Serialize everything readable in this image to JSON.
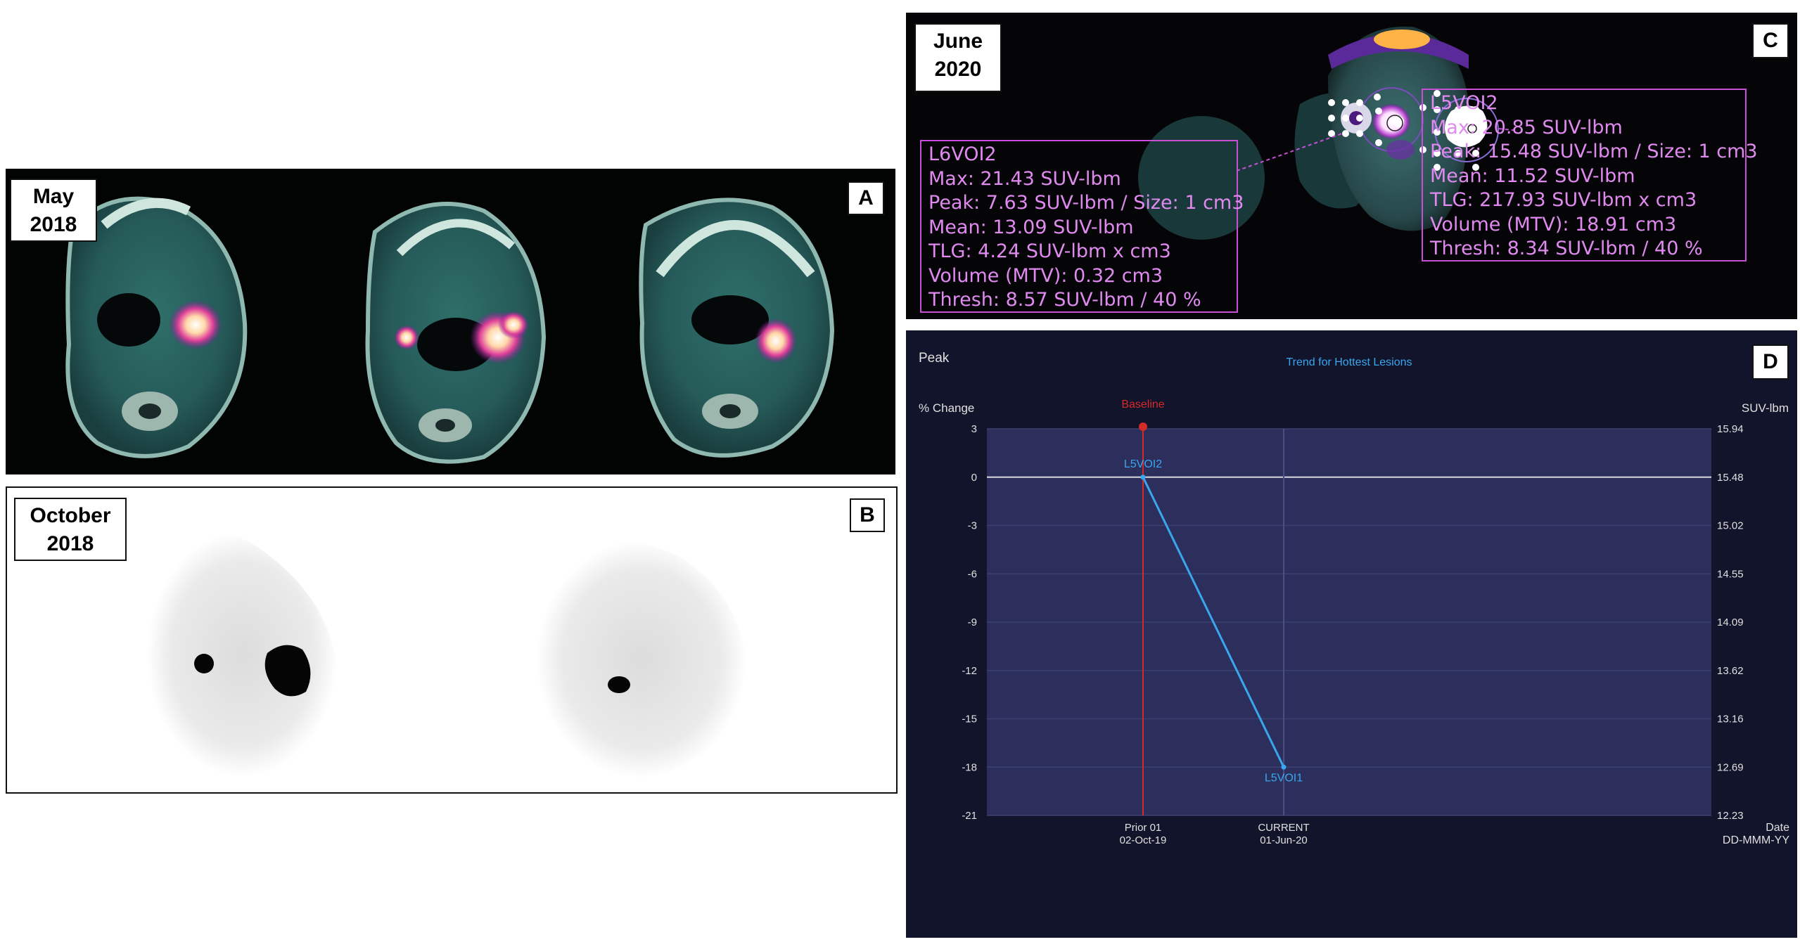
{
  "panel_a": {
    "letter": "A",
    "date_line1": "May",
    "date_line2": "2018"
  },
  "panel_b": {
    "letter": "B",
    "date_line1": "October",
    "date_line2": "2018"
  },
  "panel_c": {
    "letter": "C",
    "date_line1": "June",
    "date_line2": "2020",
    "voi_left": {
      "name": "L6VOI2",
      "max": "Max: 21.43 SUV-lbm",
      "peak": "Peak: 7.63 SUV-lbm / Size: 1 cm3",
      "mean": "Mean: 13.09 SUV-lbm",
      "tlg": "TLG: 4.24 SUV-lbm x cm3",
      "volume": "Volume (MTV): 0.32 cm3",
      "thresh": "Thresh: 8.57 SUV-lbm / 40 %"
    },
    "voi_right": {
      "name": "L5VOI2",
      "max": "Max: 20.85 SUV-lbm",
      "peak": "Peak: 15.48 SUV-lbm / Size: 1 cm3",
      "mean": "Mean: 11.52 SUV-lbm",
      "tlg": "TLG: 217.93 SUV-lbm x cm3",
      "volume": "Volume (MTV): 18.91 cm3",
      "thresh": "Thresh: 8.34 SUV-lbm / 40 %"
    }
  },
  "panel_d": {
    "letter": "D",
    "corner_label": "Peak",
    "left_axis_title": "% Change",
    "right_axis_title": "SUV-lbm",
    "x_axis_title_line1": "Date",
    "x_axis_title_line2": "DD-MMM-YY",
    "colors": {
      "background": "#11142a",
      "plot": "#2c2f5c",
      "series": "#39a7ee",
      "baseline": "#d42a2a",
      "text": "#e0e0e0"
    }
  },
  "chart_data": {
    "type": "line",
    "title": "Trend for Hottest Lesions",
    "ylabel": "% Change",
    "ylabel_right": "SUV-lbm",
    "xlabel": "Date DD-MMM-YY",
    "ylim": [
      -21,
      3
    ],
    "y_ticks": [
      3,
      0,
      -3,
      -6,
      -9,
      -12,
      -15,
      -18,
      -21
    ],
    "y_right_ticks": [
      "15.94",
      "15.48",
      "15.02",
      "14.55",
      "14.09",
      "13.62",
      "13.16",
      "12.69",
      "12.23"
    ],
    "categories": [
      {
        "line1": "Prior 01",
        "line2": "02-Oct-19"
      },
      {
        "line1": "CURRENT",
        "line2": "01-Jun-20"
      }
    ],
    "baseline_label": "Baseline",
    "grid": true,
    "series": [
      {
        "points": [
          {
            "x": "02-Oct-19",
            "y": 0,
            "label": "L5VOI2"
          },
          {
            "x": "01-Jun-20",
            "y": -18,
            "label": "L5VOI1"
          }
        ]
      }
    ]
  }
}
